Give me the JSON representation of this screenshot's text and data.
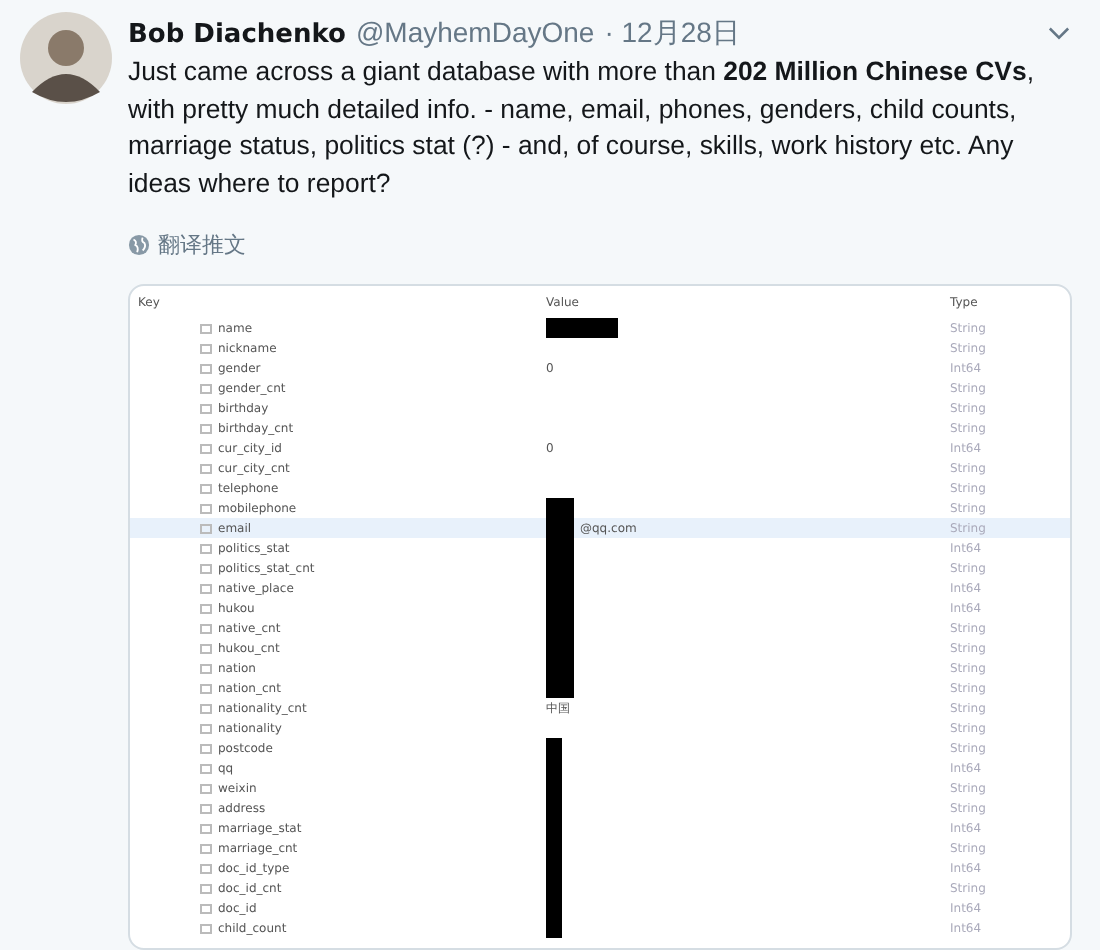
{
  "tweet": {
    "author": "Bob Diachenko",
    "handle": "@MayhemDayOne",
    "date": "· 12月28日",
    "text": "Just came across a giant database with more than **202 Million Chinese CVs**, with pretty much detailed info. - name, email, phones, genders, child counts, marriage status, politics stat (?) - and, of course, skills, work history etc. Any ideas where to report?",
    "translate": "翻译推文"
  },
  "table": {
    "columns": [
      "Key",
      "Value",
      "Type"
    ],
    "rows": [
      {
        "key": "name",
        "type": "String",
        "selected": false,
        "redacted": true
      },
      {
        "key": "nickname",
        "type": "String",
        "selected": false
      },
      {
        "key": "gender",
        "value": "0",
        "type": "Int64",
        "selected": false
      },
      {
        "key": "gender_cnt",
        "type": "String",
        "selected": false
      },
      {
        "key": "birthday",
        "type": "String",
        "selected": false
      },
      {
        "key": "birthday_cnt",
        "type": "String",
        "selected": false
      },
      {
        "key": "cur_city_id",
        "value": "0",
        "type": "Int64",
        "selected": false
      },
      {
        "key": "cur_city_cnt",
        "type": "String",
        "selected": false
      },
      {
        "key": "telephone",
        "type": "String",
        "selected": false
      },
      {
        "key": "mobilephone",
        "type": "String",
        "selected": false,
        "redacted": true
      },
      {
        "key": "email",
        "value": "@qq.com",
        "type": "String",
        "selected": true,
        "redacted": true
      },
      {
        "key": "politics_stat",
        "type": "Int64",
        "selected": false,
        "redacted": true
      },
      {
        "key": "politics_stat_cnt",
        "type": "String",
        "selected": false,
        "redacted": true
      },
      {
        "key": "native_place",
        "type": "Int64",
        "selected": false,
        "redacted": true
      },
      {
        "key": "hukou",
        "type": "Int64",
        "selected": false,
        "redacted": true
      },
      {
        "key": "native_cnt",
        "type": "String",
        "selected": false,
        "redacted": true
      },
      {
        "key": "hukou_cnt",
        "type": "String",
        "selected": false,
        "redacted": true
      },
      {
        "key": "nation",
        "type": "String",
        "selected": false,
        "redacted": true
      },
      {
        "key": "nation_cnt",
        "type": "String",
        "selected": false,
        "redacted": true
      },
      {
        "key": "nationality_cnt",
        "value": "中国",
        "type": "String",
        "selected": false
      },
      {
        "key": "nationality",
        "type": "String",
        "selected": false
      },
      {
        "key": "postcode",
        "type": "String",
        "selected": false,
        "redacted": true
      },
      {
        "key": "qq",
        "type": "Int64",
        "selected": false,
        "redacted": true
      },
      {
        "key": "weixin",
        "type": "String",
        "selected": false,
        "redacted": true
      },
      {
        "key": "address",
        "type": "String",
        "selected": false,
        "redacted": true
      },
      {
        "key": "marriage_stat",
        "type": "Int64",
        "selected": false,
        "redacted": true
      },
      {
        "key": "marriage_cnt",
        "type": "String",
        "selected": false,
        "redacted": true
      },
      {
        "key": "doc_id_type",
        "type": "Int64",
        "selected": false,
        "redacted": true
      },
      {
        "key": "doc_id_cnt",
        "type": "String",
        "selected": false,
        "redacted": true
      },
      {
        "key": "doc_id",
        "type": "Int64",
        "selected": false,
        "redacted": true
      },
      {
        "key": "child_count",
        "type": "Int64",
        "selected": false,
        "redacted": true
      }
    ]
  }
}
